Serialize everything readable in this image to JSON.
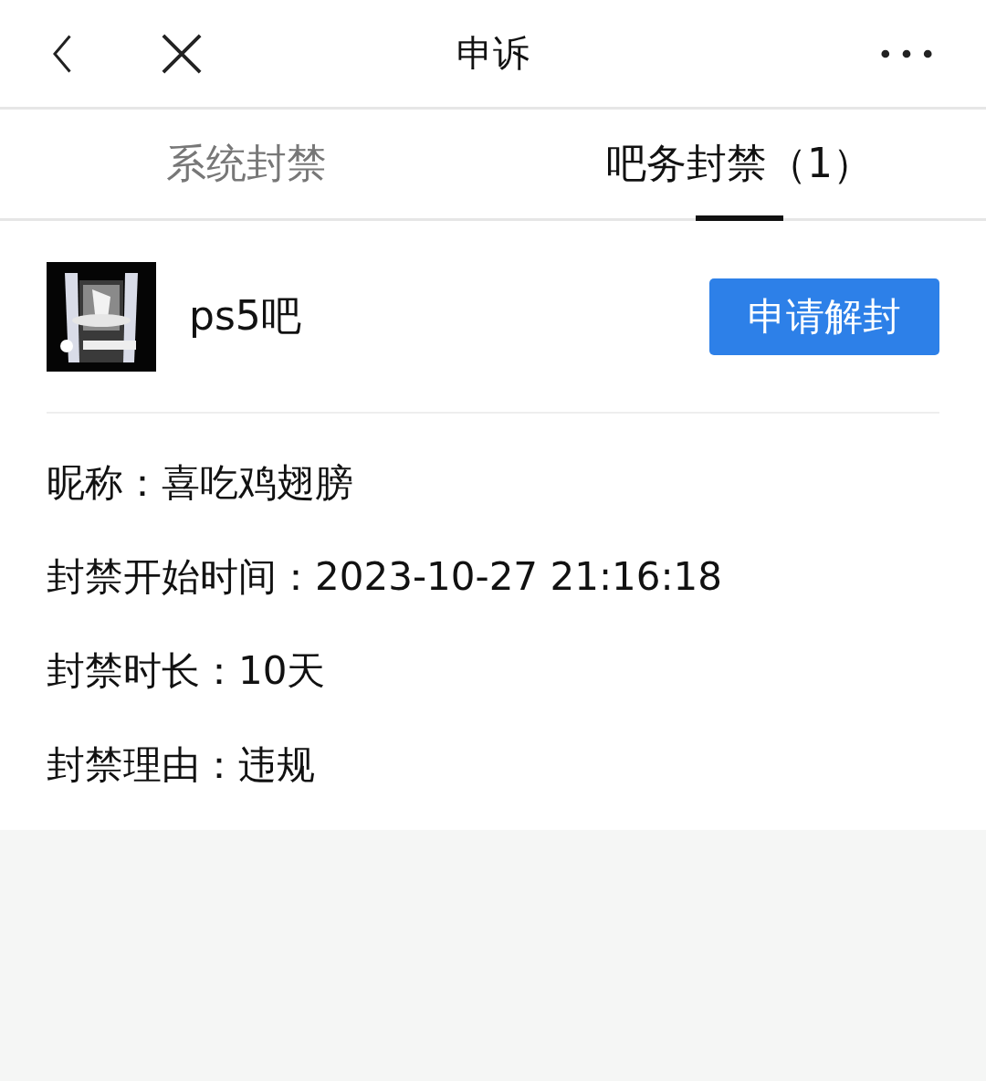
{
  "header": {
    "title": "申诉"
  },
  "tabs": [
    {
      "label": "系统封禁",
      "selected": false
    },
    {
      "label": "吧务封禁（1）",
      "selected": true
    }
  ],
  "forum": {
    "name": "ps5吧",
    "button": "申请解封"
  },
  "details": [
    {
      "label": "昵称：",
      "value": "喜吃鸡翅膀"
    },
    {
      "label": "封禁开始时间：",
      "value": "2023-10-27 21:16:18"
    },
    {
      "label": "封禁时长：",
      "value": "10天"
    },
    {
      "label": "封禁理由：",
      "value": "违规"
    }
  ]
}
